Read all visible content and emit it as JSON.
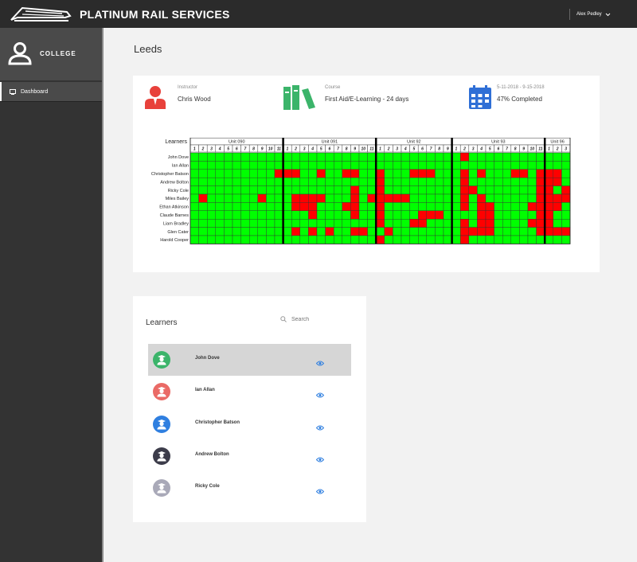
{
  "header": {
    "brand": "PLATINUM RAIL SERVICES",
    "user_name": "Alex Pedley"
  },
  "sidebar": {
    "college_label": "COLLEGE",
    "nav_items": [
      {
        "label": "Dashboard",
        "active": true
      }
    ]
  },
  "page": {
    "title": "Leeds"
  },
  "summary": {
    "instructor": {
      "label": "Instructor",
      "value": "Chris Wood",
      "icon": "person-icon",
      "color": "#e8413b"
    },
    "course": {
      "label": "Course",
      "value": "First Aid/E-Learning - 24 days",
      "icon": "books-icon",
      "color": "#3bb46a"
    },
    "dates": {
      "label": "5-11-2018  -  9-15-2018",
      "value": "47% Completed",
      "icon": "calendar-icon",
      "color": "#2f6fd6",
      "percent": 47
    }
  },
  "progress_matrix": {
    "row_header": "Learners",
    "colors": {
      "done": "#00ff00",
      "missed": "#ff0000"
    },
    "units": [
      {
        "name": "Unit 090",
        "columns": [
          "1",
          "2",
          "3",
          "4",
          "5",
          "6",
          "7",
          "8",
          "9",
          "10",
          "11"
        ]
      },
      {
        "name": "Unit 091",
        "columns": [
          "1",
          "2",
          "3",
          "4",
          "5",
          "6",
          "7",
          "8",
          "9",
          "10",
          "11"
        ]
      },
      {
        "name": "Unit 92",
        "columns": [
          "1",
          "2",
          "3",
          "4",
          "5",
          "6",
          "7",
          "8",
          "9"
        ]
      },
      {
        "name": "Unit 93",
        "columns": [
          "1",
          "2",
          "3",
          "4",
          "5",
          "6",
          "7",
          "8",
          "9",
          "10",
          "11"
        ]
      },
      {
        "name": "Unit 96",
        "columns": [
          "1",
          "2",
          "3"
        ]
      }
    ],
    "learners": [
      "John Dove",
      "Ian Allan",
      "Christopher Batson",
      "Andrew Bolton",
      "Ricky Cole",
      "Miles Bailey",
      "Ethan Atkinson",
      "Claude Barnes",
      "Liam Bradley",
      "Glen Cater",
      "Harold Cooper"
    ],
    "cells": [
      "00000000000000000000000000000000100000000000000010",
      "00000000000000000000000000000000000000000000000000",
      "00000000001110010011001000111000101000110111011111",
      "00000000000000000000001000000000100000000111001011",
      "00000000000000000001001000000000110000000110100111",
      "01000000100011110001011111000000101000000111101111",
      "00000000000011100011001000000000101100001111000011",
      "00000000000000100001001000011100001100000110011111",
      "00000000000000000000001000110000101100001110000111",
      "00000000000010101001100100000000111100000111101110",
      "00000000000000000000001000000000100000000000000111"
    ]
  },
  "learners_card": {
    "title": "Learners",
    "search_placeholder": "Search",
    "items": [
      {
        "name": "John Dove",
        "avatar_color": "#3bb46a",
        "selected": true
      },
      {
        "name": "Ian Allan",
        "avatar_color": "#ea6a66",
        "selected": false
      },
      {
        "name": "Christopher Batson",
        "avatar_color": "#2f7fe0",
        "selected": false
      },
      {
        "name": "Andrew Bolton",
        "avatar_color": "#3c3c4a",
        "selected": false
      },
      {
        "name": "Ricky Cole",
        "avatar_color": "#a9a9b8",
        "selected": false
      }
    ],
    "view_icon": "eye-icon",
    "view_icon_color": "#2f7fe0"
  }
}
